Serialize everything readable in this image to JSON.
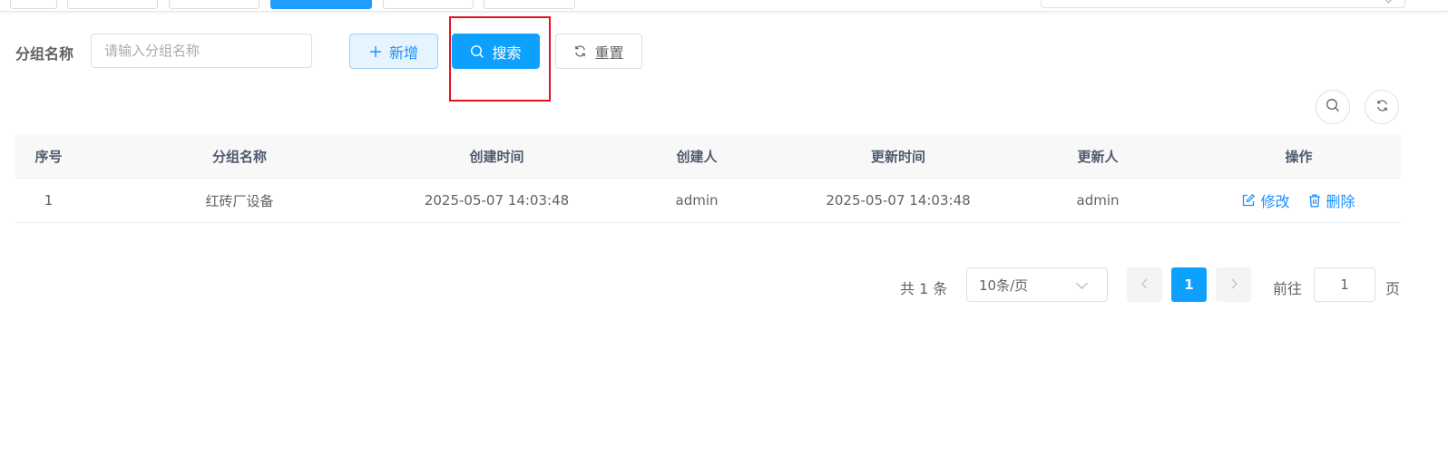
{
  "search_form": {
    "group_name_label": "分组名称",
    "group_name_placeholder": "请输入分组名称",
    "group_name_value": "",
    "add_label": "新增",
    "search_label": "搜索",
    "reset_label": "重置"
  },
  "table": {
    "columns": [
      "序号",
      "分组名称",
      "创建时间",
      "创建人",
      "更新时间",
      "更新人",
      "操作"
    ],
    "rows": [
      {
        "index": "1",
        "group_name": "红砖厂设备",
        "created_at": "2025-05-07 14:03:48",
        "created_by": "admin",
        "updated_at": "2025-05-07 14:03:48",
        "updated_by": "admin",
        "edit_label": "修改",
        "delete_label": "删除"
      }
    ]
  },
  "pagination": {
    "total_text": "共 1 条",
    "page_size": "10条/页",
    "current_page": "1",
    "goto_label": "前往",
    "goto_value": "1",
    "page_suffix": "页"
  },
  "icons": {
    "add": "plus-icon",
    "search": "search-icon",
    "reset": "refresh-icon",
    "edit": "edit-icon",
    "delete": "trash-icon"
  },
  "colors": {
    "primary": "#0ea0ff",
    "link": "#1890ff",
    "highlight_border": "#e8101e"
  }
}
